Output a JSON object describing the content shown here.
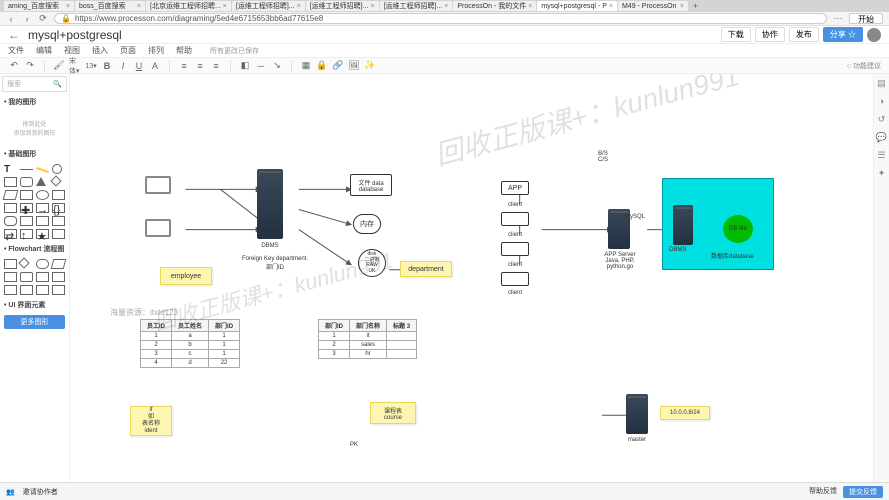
{
  "browser": {
    "tabs": [
      {
        "label": "aming_百度搜索"
      },
      {
        "label": "boss_百度搜索"
      },
      {
        "label": "[北京运维工程师招聘..."
      },
      {
        "label": "[运维工程师招聘]..."
      },
      {
        "label": "[运维工程师招聘]..."
      },
      {
        "label": "[运维工程师招聘]..."
      },
      {
        "label": "ProcessOn - 我的文件"
      },
      {
        "label": "mysql+postgresql - P",
        "active": true
      },
      {
        "label": "M49 - ProcessOn"
      }
    ],
    "url": "https://www.processon.com/diagraming/5ed4e6715653bb6ad77615e8",
    "start_btn": "开始"
  },
  "doc": {
    "title": "mysql+postgresql"
  },
  "header_buttons": {
    "download": "下载",
    "coop": "协作",
    "publish": "发布",
    "share": "分享 ☆"
  },
  "menu": {
    "file": "文件",
    "edit": "编辑",
    "view": "视图",
    "insert": "插入",
    "page": "页面",
    "arrange": "排列",
    "help": "帮助",
    "save_status": "所有更改已保存"
  },
  "sidebar": {
    "search_placeholder": "搜索",
    "my_shapes": "• 我的图形",
    "drop_hint": "拖到此处\n添加到我的图形",
    "basic_shapes": "• 基础图形",
    "flowchart": "• Flowchart 流程图",
    "ui_elements": "• UI 界面元素",
    "more": "更多图形"
  },
  "canvas": {
    "bs_cs": "B/S\nC/S",
    "data_file": "文件 data\ndatabase",
    "memory": "内存",
    "disk": "disk\n二进制\nRAW\nUK",
    "dbms": "DBMS",
    "fk_text": "Foreign Key\ndepartment.部门ID",
    "employee": "employee",
    "department": "department",
    "app": "APP",
    "client": "client",
    "appserver": "APP Server\nJava, PHP,\npython,go",
    "mysql": "MySQL",
    "dbms2": "DBMS",
    "dbfile": "DB file",
    "dbstore": "数据库database",
    "course": "课程表\ncourse",
    "pk": "PK",
    "ip": "10.0.0.8/24",
    "master": "master",
    "if_lines": "if\n如\n表名称\nident"
  },
  "table1": {
    "headers": [
      "员工ID",
      "员工姓名",
      "部门ID"
    ],
    "rows": [
      [
        "1",
        "a",
        "1"
      ],
      [
        "2",
        "b",
        "1"
      ],
      [
        "3",
        "c",
        "1"
      ],
      [
        "4",
        "d",
        "22"
      ]
    ]
  },
  "table2": {
    "headers": [
      "部门ID",
      "部门名称",
      "标题 3"
    ],
    "rows": [
      [
        "1",
        "it",
        ""
      ],
      [
        "2",
        "sales",
        ""
      ],
      [
        "3",
        "hr",
        ""
      ]
    ]
  },
  "watermarks": {
    "big": "回收正版课+：kunlun991",
    "res": "海量资源：itxtd123"
  },
  "footer": {
    "collab": "邀请协作者",
    "feedback": "帮助反馈",
    "submit": "提交反馈"
  },
  "feature_toggle": "○ 功能建议"
}
